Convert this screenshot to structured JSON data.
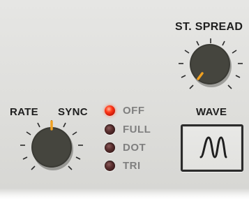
{
  "rate_section": {
    "rate_label": "RATE",
    "sync_label": "SYNC",
    "rate_knob": {
      "icon": "rate-knob",
      "indicator_color": "#f0a020"
    }
  },
  "spread_section": {
    "label": "ST. SPREAD",
    "knob": {
      "icon": "spread-knob",
      "indicator_color": "#f0a020"
    }
  },
  "sync_modes": [
    {
      "label": "OFF",
      "active": true
    },
    {
      "label": "FULL",
      "active": false
    },
    {
      "label": "DOT",
      "active": false
    },
    {
      "label": "TRI",
      "active": false
    }
  ],
  "wave_section": {
    "label": "WAVE",
    "button_icon": "sine-wave-icon"
  },
  "colors": {
    "panel": "#dededb",
    "knob": "#3a3a35",
    "led_on": "#ff3a1a",
    "led_off": "#4a2424",
    "text_dark": "#1e1e1e",
    "text_muted": "#7f7f7f"
  }
}
